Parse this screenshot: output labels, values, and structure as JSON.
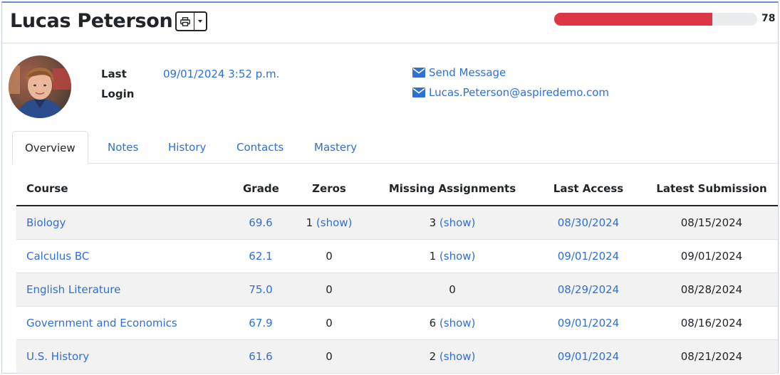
{
  "student": {
    "name": "Lucas Peterson",
    "progress_value": "78",
    "progress_fraction": 0.78,
    "last_login_label": "Last Login",
    "last_login_value": "09/01/2024 3:52 p.m.",
    "send_message": "Send Message",
    "email": "Lucas.Peterson@aspiredemo.com"
  },
  "icons": {
    "print": "printer-icon",
    "caret": "caret-down-icon",
    "mail": "envelope-icon"
  },
  "colors": {
    "link": "#2f6fd6",
    "progress_fill": "#dc3545",
    "progress_track": "#e9ecef",
    "stripe": "#f2f2f2"
  },
  "tabs": [
    {
      "label": "Overview",
      "active": true
    },
    {
      "label": "Notes",
      "active": false
    },
    {
      "label": "History",
      "active": false
    },
    {
      "label": "Contacts",
      "active": false
    },
    {
      "label": "Mastery",
      "active": false
    }
  ],
  "table": {
    "headers": {
      "course": "Course",
      "grade": "Grade",
      "zeros": "Zeros",
      "missing": "Missing Assignments",
      "last_access": "Last Access",
      "latest_submission": "Latest Submission"
    },
    "rows": [
      {
        "course": "Biology",
        "grade": "69.6",
        "zeros": "1",
        "zeros_link": "(show)",
        "missing": "3",
        "missing_link": "(show)",
        "last_access": "08/30/2024",
        "latest_submission": "08/15/2024"
      },
      {
        "course": "Calculus BC",
        "grade": "62.1",
        "zeros": "0",
        "zeros_link": "",
        "missing": "1",
        "missing_link": "(show)",
        "last_access": "09/01/2024",
        "latest_submission": "09/01/2024"
      },
      {
        "course": "English Literature",
        "grade": "75.0",
        "zeros": "0",
        "zeros_link": "",
        "missing": "0",
        "missing_link": "",
        "last_access": "08/29/2024",
        "latest_submission": "08/28/2024"
      },
      {
        "course": "Government and Economics",
        "grade": "67.9",
        "zeros": "0",
        "zeros_link": "",
        "missing": "6",
        "missing_link": "(show)",
        "last_access": "09/01/2024",
        "latest_submission": "08/16/2024"
      },
      {
        "course": "U.S. History",
        "grade": "61.6",
        "zeros": "0",
        "zeros_link": "",
        "missing": "2",
        "missing_link": "(show)",
        "last_access": "09/01/2024",
        "latest_submission": "08/21/2024"
      }
    ]
  }
}
